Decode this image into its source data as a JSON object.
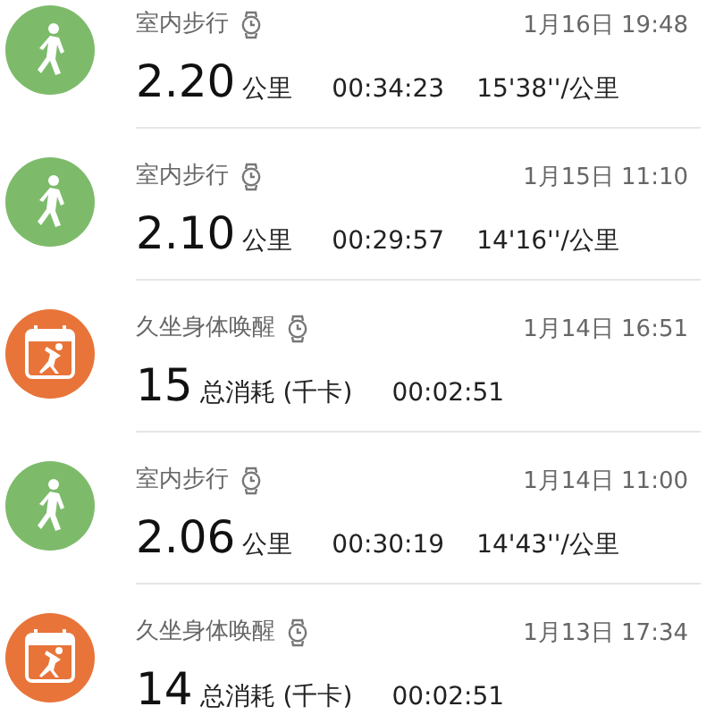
{
  "records": [
    {
      "kind": "walk",
      "title": "室内步行",
      "date": "1月16日 19:48",
      "value": "2.20",
      "unit": "公里",
      "duration": "00:34:23",
      "pace": "15'38''/公里"
    },
    {
      "kind": "walk",
      "title": "室内步行",
      "date": "1月15日 11:10",
      "value": "2.10",
      "unit": "公里",
      "duration": "00:29:57",
      "pace": "14'16''/公里"
    },
    {
      "kind": "sedentary",
      "title": "久坐身体唤醒",
      "date": "1月14日 16:51",
      "value": "15",
      "unit": "总消耗 (千卡)",
      "duration": "00:02:51"
    },
    {
      "kind": "walk",
      "title": "室内步行",
      "date": "1月14日 11:00",
      "value": "2.06",
      "unit": "公里",
      "duration": "00:30:19",
      "pace": "14'43''/公里"
    },
    {
      "kind": "sedentary",
      "title": "久坐身体唤醒",
      "date": "1月13日 17:34",
      "value": "14",
      "unit": "总消耗 (千卡)",
      "duration": "00:02:51"
    }
  ]
}
